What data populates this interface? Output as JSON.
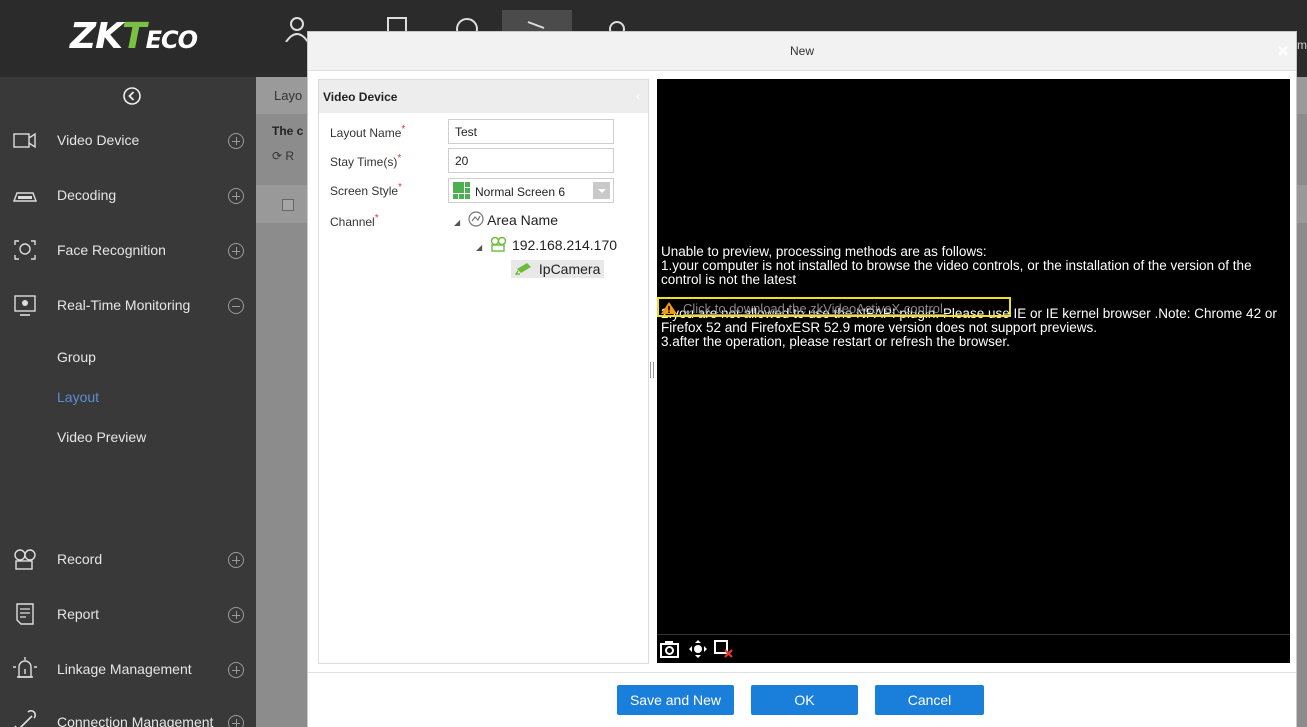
{
  "header": {
    "logo_main": "ZK",
    "logo_t": "T",
    "logo_eco": "ECO",
    "right_text": "m",
    "icons": [
      "person-icon",
      "document-icon",
      "globe-icon",
      "video-icon",
      "gear-icon"
    ]
  },
  "sidebar": {
    "items": [
      {
        "label": "Video Device",
        "icon": "camera-icon",
        "toggle": "plus"
      },
      {
        "label": "Decoding",
        "icon": "decoder-icon",
        "toggle": "plus"
      },
      {
        "label": "Face Recognition",
        "icon": "face-scan-icon",
        "toggle": "plus"
      },
      {
        "label": "Real-Time Monitoring",
        "icon": "monitor-icon",
        "toggle": "minus"
      },
      {
        "label": "Record",
        "icon": "record-icon",
        "toggle": "plus"
      },
      {
        "label": "Report",
        "icon": "report-icon",
        "toggle": "plus"
      },
      {
        "label": "Linkage Management",
        "icon": "alarm-icon",
        "toggle": "plus"
      },
      {
        "label": "Connection Management",
        "icon": "link-icon",
        "toggle": "plus"
      }
    ],
    "sub_items": [
      {
        "label": "Group",
        "active": false
      },
      {
        "label": "Layout",
        "active": true
      },
      {
        "label": "Video Preview",
        "active": false
      }
    ]
  },
  "background": {
    "tab": "Layo",
    "line2": "The c",
    "refresh": "R"
  },
  "dialog": {
    "title": "New",
    "close": "×",
    "panel_title": "Video Device",
    "panel_arrow": "‹",
    "form": {
      "layout_name_label": "Layout Name",
      "layout_name_value": "Test",
      "stay_time_label": "Stay Time(s)",
      "stay_time_value": "20",
      "screen_style_label": "Screen Style",
      "screen_style_value": "Normal Screen 6",
      "channel_label": "Channel",
      "required_mark": "*"
    },
    "tree": {
      "root": "Area Name",
      "device": "192.168.214.170",
      "camera": "IpCamera"
    },
    "video": {
      "messages": [
        "Unable to preview, processing methods are as follows:",
        "1.your computer is not installed to browse the video controls, or the installation of the version of the control is not the latest",
        "2.you are not allowed to use the NPAPI plugin. Please use IE or IE kernel browser .Note: Chrome 42 or Firefox 52 and FirefoxESR 52.9 more version does not support previews.",
        "3.after the operation, please restart or refresh the browser."
      ],
      "download_link": "Click to download the zkVideoActiveX control."
    },
    "buttons": {
      "save_new": "Save and New",
      "ok": "OK",
      "cancel": "Cancel"
    }
  },
  "colors": {
    "primary": "#1a7fdb",
    "sidebar_bg": "#393939",
    "header_bg": "#2b2b2b",
    "active_link": "#5a8ed1",
    "highlight": "#f3e117",
    "logo_accent": "#7ac143"
  }
}
